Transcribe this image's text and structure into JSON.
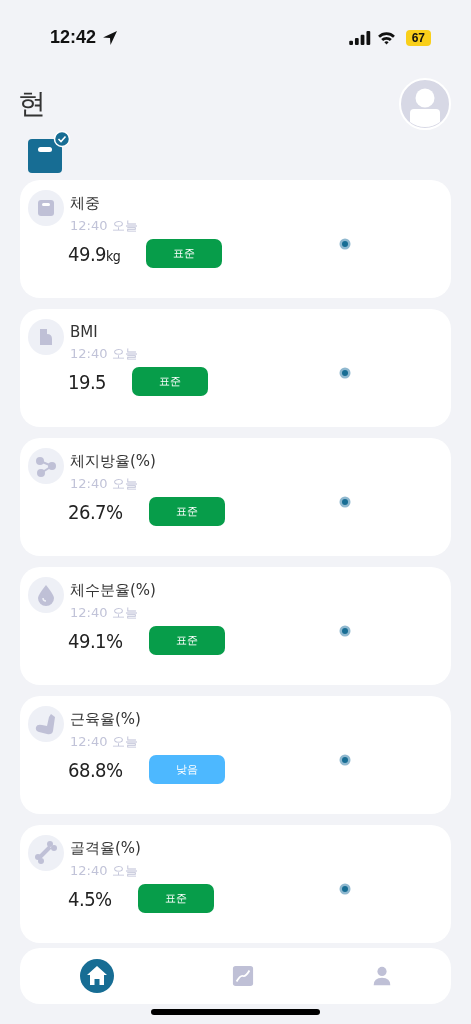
{
  "status_bar": {
    "time": "12:42",
    "battery": "67"
  },
  "header": {
    "title": "현",
    "device": {
      "connected": true
    }
  },
  "metrics": [
    {
      "kind": "scale",
      "name": "체중",
      "time": "12:40 오늘",
      "value": "49.9",
      "unit": "kg",
      "status": {
        "color": "#079d4a",
        "label": "표준"
      }
    },
    {
      "kind": "bmi",
      "name": "BMI",
      "time": "12:40 오늘",
      "value": "19.5",
      "status": {
        "color": "#079d4a",
        "label": "표준"
      }
    },
    {
      "kind": "fat",
      "name": "체지방율(%)",
      "time": "12:40 오늘",
      "value": "26.7%",
      "status": {
        "color": "#079d4a",
        "label": "표준"
      }
    },
    {
      "kind": "water",
      "name": "체수분율(%)",
      "time": "12:40 오늘",
      "value": "49.1%",
      "status": {
        "color": "#079d4a",
        "label": "표준"
      }
    },
    {
      "kind": "muscle",
      "name": "근육율(%)",
      "time": "12:40 오늘",
      "value": "68.8%",
      "status": {
        "color": "#4db8ff",
        "label": "낮음"
      }
    },
    {
      "kind": "bone",
      "name": "골격율(%)",
      "time": "12:40 오늘",
      "value": "4.5%",
      "status": {
        "color": "#079d4a",
        "label": "표준"
      }
    }
  ],
  "nav": [
    {
      "kind": "home",
      "selected": true
    },
    {
      "kind": "chart",
      "selected": false
    },
    {
      "kind": "profile",
      "selected": false
    }
  ]
}
